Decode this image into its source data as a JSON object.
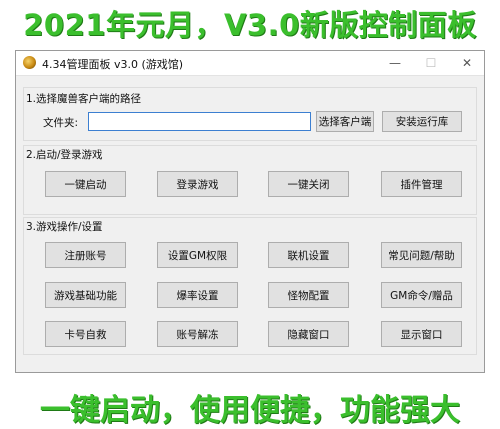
{
  "banner": {
    "top_text": "2021年元月，V3.0新版控制面板",
    "bottom_text": "一键启动，使用便捷，功能强大"
  },
  "window": {
    "title": "4.34管理面板 v3.0 (游戏馆)",
    "controls": {
      "minimize": "—",
      "maximize": "☐",
      "close": "✕"
    }
  },
  "section1": {
    "title": "1.选择魔兽客户端的路径",
    "folder_label": "文件夹:",
    "path_value": "",
    "select_client_button": "选择客户端",
    "install_runtime_button": "安装运行库"
  },
  "section2": {
    "title": "2.启动/登录游戏",
    "buttons": [
      "一键启动",
      "登录游戏",
      "一键关闭",
      "插件管理"
    ]
  },
  "section3": {
    "title": "3.游戏操作/设置",
    "buttons": [
      "注册账号",
      "设置GM权限",
      "联机设置",
      "常见问题/帮助",
      "游戏基础功能",
      "爆率设置",
      "怪物配置",
      "GM命令/赠品",
      "卡号自救",
      "账号解冻",
      "隐藏窗口",
      "显示窗口"
    ]
  }
}
